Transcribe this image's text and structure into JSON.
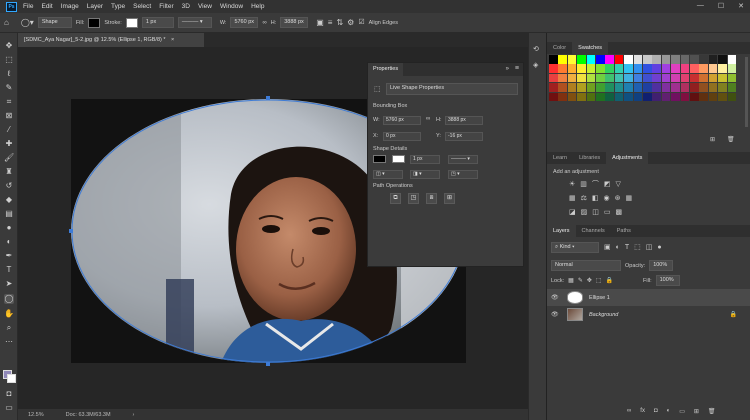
{
  "menu": {
    "logo": "Ps",
    "items": [
      "File",
      "Edit",
      "Image",
      "Layer",
      "Type",
      "Select",
      "Filter",
      "3D",
      "View",
      "Window",
      "Help"
    ],
    "window_controls": [
      "—",
      "☐",
      "✕"
    ]
  },
  "options": {
    "tool_mode": "Shape",
    "fill_label": "Fill:",
    "stroke_label": "Stroke:",
    "stroke_width": "1 px",
    "w_label": "W:",
    "w_value": "5760 px",
    "h_label": "H:",
    "h_value": "3888 px",
    "align_edges": "Align Edges"
  },
  "document": {
    "tab_title": "[SDMC_Aya Nagar]_5-2.jpg @ 12.5% (Ellipse 1, RGB/8) *",
    "zoom": "12.5%",
    "doc_size": "Doc: 63.3M/63.3M"
  },
  "properties": {
    "title": "Properties",
    "subtitle": "Live Shape Properties",
    "bounding_box": "Bounding Box",
    "w_label": "W:",
    "w_value": "5760 px",
    "h_label": "H:",
    "h_value": "3888 px",
    "x_label": "X:",
    "x_value": "0 px",
    "y_label": "Y:",
    "y_value": "-16 px",
    "shape_details": "Shape Details",
    "stroke_width": "1 px",
    "path_operations": "Path Operations"
  },
  "swatches": {
    "tabs": [
      "Color",
      "Swatches"
    ],
    "colors": [
      "#000000",
      "#ffff00",
      "#ffff33",
      "#00ff00",
      "#00ffff",
      "#0000ff",
      "#ff00ff",
      "#ff0000",
      "#ffffff",
      "#e0e0e0",
      "#c8c8c8",
      "#b0b0b0",
      "#989898",
      "#808080",
      "#686868",
      "#505050",
      "#383838",
      "#202020",
      "#101010",
      "#ffffff",
      "#ff3030",
      "#ff7a30",
      "#ffb030",
      "#ffee30",
      "#c8f030",
      "#80e030",
      "#30d060",
      "#30d0b0",
      "#30c0f0",
      "#3090f0",
      "#3050e0",
      "#6040e0",
      "#a040e0",
      "#e040c0",
      "#f04080",
      "#ff6060",
      "#ff9a60",
      "#ffc890",
      "#fff0a0",
      "#d0f0a0",
      "#e84040",
      "#f08040",
      "#f0b040",
      "#f0e040",
      "#b0e040",
      "#70d040",
      "#40c070",
      "#40c0b0",
      "#40b0e0",
      "#4080e0",
      "#4050d0",
      "#7040d0",
      "#a040d0",
      "#d040b0",
      "#e04070",
      "#c83030",
      "#d07030",
      "#d0a030",
      "#c8c030",
      "#90c030",
      "#a02020",
      "#b05020",
      "#b08020",
      "#b0a020",
      "#70a020",
      "#40a030",
      "#209060",
      "#209090",
      "#2080b0",
      "#2060b0",
      "#2040a0",
      "#5030a0",
      "#8030a0",
      "#a03090",
      "#b03060",
      "#902020",
      "#905020",
      "#907020",
      "#808020",
      "#508020",
      "#701010",
      "#803010",
      "#805010",
      "#807010",
      "#507010",
      "#207020",
      "#106040",
      "#106070",
      "#105080",
      "#104080",
      "#102070",
      "#402070",
      "#602070",
      "#701060",
      "#801040",
      "#601010",
      "#603010",
      "#604010",
      "#605010",
      "#405010"
    ]
  },
  "adjustments": {
    "tabs": [
      "Learn",
      "Libraries",
      "Adjustments"
    ],
    "add_label": "Add an adjustment"
  },
  "layers": {
    "tabs": [
      "Layers",
      "Channels",
      "Paths"
    ],
    "kind": "Kind",
    "blend_mode": "Normal",
    "opacity_label": "Opacity:",
    "opacity": "100%",
    "lock_label": "Lock:",
    "fill_label": "Fill:",
    "fill": "100%",
    "items": [
      {
        "name": "Ellipse 1"
      },
      {
        "name": "Background"
      }
    ]
  }
}
